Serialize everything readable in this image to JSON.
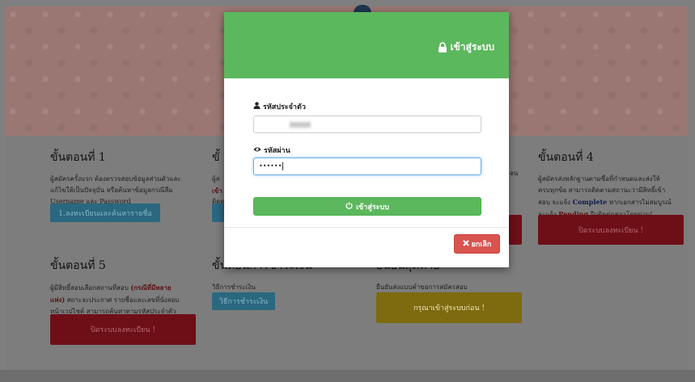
{
  "steps": [
    {
      "title": "ขั้นตอนที่ 1",
      "lines": [
        "ผู้สมัครครั้งแรก ต้องตรวจสอบข้อมูลส่วนตัวและ",
        "แก้ไขให้เป็นปัจจุบัน หรือค้นหาข้อมูลกรณีลืม",
        "Username และ Password"
      ],
      "button": "1.ลงทะเบียนและค้นหารายชื่อ"
    },
    {
      "title": "ขั้",
      "lines": [
        "ผู้ส",
        "เข้า",
        "ติดต"
      ],
      "button": ""
    },
    {
      "title": "ขั้นตอนที่ 4",
      "lines": [
        "ผู้สมัครส่งหลักฐานตามชื่อที่กำหนดและส่งให้",
        "ครบทุกข้อ สามารถติดตามสถานะว่ามีสิทธิ์เข้า",
        "สอบ จะแจ้ง",
        "Complete",
        "หากเอกสารไม่สมบูรณ์",
        "จะแจ้ง",
        "Pending",
        "รีบติดต่อสภาโดยด่วน!"
      ],
      "button": "ปิดระบบลงทะเบียน !"
    },
    {
      "title": "ขั้นตอนที่ 5",
      "lines": [
        "ผู้มีสิทธิ์สอบเลือกสถานที่สอบ",
        "(กรณีที่มีหลาย",
        "แห่ง)",
        "สถาะจะประกาศ รายชื่อและเลขที่นั่งสอบ",
        "หน้าเวปไซต์ สามารถค้นหาตามรหัสประจำตัว"
      ],
      "button": "ปิดระบบลงทะเบียน !"
    },
    {
      "title": "ขั้นตอนการชำระเงิน",
      "lines": [
        "วิธีการชำระเงิน"
      ],
      "button": "วิธีการชำระเงิน"
    },
    {
      "title": "ยืนยันสุดท้าย",
      "lines": [
        "ยืนยันส่งแบบคำขอการสมัครสอบ"
      ],
      "button": "กรุณาเข้าสู่ระบบก่อน !"
    }
  ],
  "middle_fragment": "อน",
  "modal": {
    "title": "เข้าสู่ระบบ",
    "icon": "lock-icon",
    "id_label": "รหัสประจำตัว",
    "id_value": "",
    "password_label": "รหัสผ่าน",
    "password_value": "••••••",
    "login_button": "เข้าสู่ระบบ",
    "cancel_button": "ยกเลิก"
  },
  "colors": {
    "header_green": "#5cb85c",
    "cancel_red": "#d9534f"
  }
}
